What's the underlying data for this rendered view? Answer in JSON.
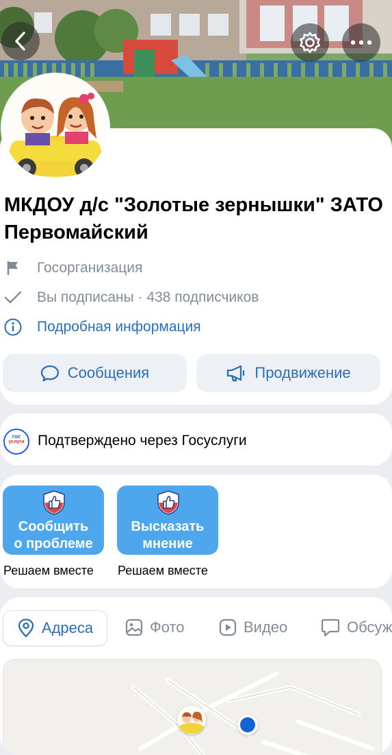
{
  "header": {
    "back_icon": "chevron-left-icon",
    "settings_icon": "gear-icon",
    "more_icon": "more-horizontal-icon"
  },
  "profile": {
    "title": "МКДОУ д/с \"Золотые зернышки\" ЗАТО Первомайский",
    "category": "Госорганизация",
    "subscription": "Вы подписаны · 438 подписчиков",
    "details_link": "Подробная информация"
  },
  "actions": {
    "messages_label": "Сообщения",
    "promotion_label": "Продвижение"
  },
  "verification": {
    "logo_text_1": "гос",
    "logo_text_2": "услуги",
    "text": "Подтверждено через Госуслуги"
  },
  "tiles": [
    {
      "line1": "Сообщить",
      "line2": "о проблеме",
      "caption": "Решаем вместе"
    },
    {
      "line1": "Высказать",
      "line2": "мнение",
      "caption": "Решаем вместе"
    }
  ],
  "tabs": [
    {
      "label": "Адреса",
      "icon": "location-pin-icon",
      "active": true
    },
    {
      "label": "Фото",
      "icon": "photo-icon",
      "active": false
    },
    {
      "label": "Видео",
      "icon": "video-icon",
      "active": false
    },
    {
      "label": "Обсуждения",
      "icon": "discussion-icon",
      "active": false
    }
  ],
  "colors": {
    "accent": "#2a6eb4",
    "tile_blue": "#4ea7ec",
    "secondary_text": "#818c99",
    "background": "#ebedf0"
  }
}
